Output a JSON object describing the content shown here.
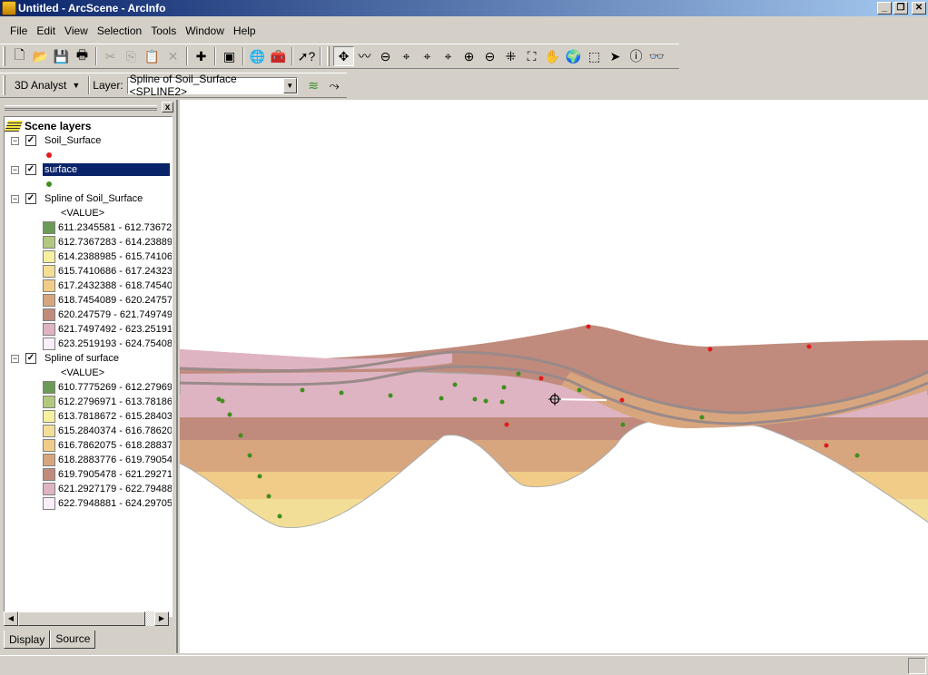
{
  "window": {
    "title": "Untitled - ArcScene - ArcInfo",
    "minimize": "_",
    "restore": "❐",
    "close": "✕"
  },
  "menu": [
    "File",
    "Edit",
    "View",
    "Selection",
    "Tools",
    "Window",
    "Help"
  ],
  "toolbar": {
    "standard": [
      {
        "name": "new-document-icon",
        "glyph": "🗋"
      },
      {
        "name": "open-folder-icon",
        "glyph": "📂"
      },
      {
        "name": "save-icon",
        "glyph": "💾"
      },
      {
        "name": "print-icon",
        "glyph": "🖶"
      },
      {
        "name": "cut-icon",
        "glyph": "✂",
        "disabled": true
      },
      {
        "name": "copy-icon",
        "glyph": "⎘",
        "disabled": true
      },
      {
        "name": "paste-icon",
        "glyph": "📋",
        "disabled": true
      },
      {
        "name": "delete-icon",
        "glyph": "✕",
        "disabled": true
      },
      {
        "name": "add-data-icon",
        "glyph": "✚"
      },
      {
        "name": "scene-properties-icon",
        "glyph": "▣"
      },
      {
        "name": "arccatalog-globe-icon",
        "glyph": "🌐"
      },
      {
        "name": "arctoolbox-icon",
        "glyph": "🧰"
      },
      {
        "name": "whats-this-help-icon",
        "glyph": "➚?"
      }
    ],
    "tools": [
      {
        "name": "navigate-icon",
        "glyph": "✥",
        "pressed": true
      },
      {
        "name": "fly-icon",
        "glyph": "〰"
      },
      {
        "name": "zoom-in-out-icon",
        "glyph": "⊖"
      },
      {
        "name": "center-on-target-icon",
        "glyph": "⌖"
      },
      {
        "name": "zoom-to-target-icon",
        "glyph": "⌖"
      },
      {
        "name": "set-observer-icon",
        "glyph": "⌖"
      },
      {
        "name": "zoom-in-icon",
        "glyph": "⊕"
      },
      {
        "name": "zoom-out-icon",
        "glyph": "⊖"
      },
      {
        "name": "narrow-field-of-view-icon",
        "glyph": "⁜"
      },
      {
        "name": "full-extent-icon",
        "glyph": "⛶"
      },
      {
        "name": "pan-hand-icon",
        "glyph": "✋"
      },
      {
        "name": "full-extent-globe-icon",
        "glyph": "🌍"
      },
      {
        "name": "select-features-icon",
        "glyph": "⬚"
      },
      {
        "name": "select-elements-arrow-icon",
        "glyph": "➤"
      },
      {
        "name": "identify-icon",
        "glyph": "ⓘ"
      },
      {
        "name": "find-binoculars-icon",
        "glyph": "👓"
      }
    ]
  },
  "analyst": {
    "menu_label": "3D Analyst",
    "layer_label": "Layer:",
    "layer_value": "Spline of Soil_Surface <SPLINE2>",
    "contour_icon": "≋",
    "steepest_path_icon": "⤳"
  },
  "toc": {
    "title": "Scene layers",
    "layers": [
      {
        "name": "Soil_Surface",
        "checked": true,
        "symbol": "#e21b1b"
      },
      {
        "name": "surface",
        "checked": true,
        "selected": true,
        "symbol": "#3f8f1e"
      },
      {
        "name": "Spline of Soil_Surface",
        "checked": true,
        "field": "<VALUE>",
        "classes": [
          {
            "label": "611.2345581 - 612.73672",
            "color": "#6e9a58"
          },
          {
            "label": "612.7367283 - 614.23889",
            "color": "#b3c87e"
          },
          {
            "label": "614.2388985 - 615.74106",
            "color": "#f5f0a0"
          },
          {
            "label": "615.7410686 - 617.24323",
            "color": "#f2de96"
          },
          {
            "label": "617.2432388 - 618.74540",
            "color": "#f0cc88"
          },
          {
            "label": "618.7454089 - 620.24757",
            "color": "#d8a67e"
          },
          {
            "label": "620.247579 - 621.749749",
            "color": "#c08b7c"
          },
          {
            "label": "621.7497492 - 623.25191",
            "color": "#dfb4c2"
          },
          {
            "label": "623.2519193 - 624.75408",
            "color": "#fbeefb"
          }
        ]
      },
      {
        "name": "Spline of surface",
        "checked": true,
        "field": "<VALUE>",
        "classes": [
          {
            "label": "610.7775269 - 612.27969",
            "color": "#6e9a58"
          },
          {
            "label": "612.2796971 - 613.78186",
            "color": "#b3c87e"
          },
          {
            "label": "613.7818672 - 615.28403",
            "color": "#f5f0a0"
          },
          {
            "label": "615.2840374 - 616.78620",
            "color": "#f2de96"
          },
          {
            "label": "616.7862075 - 618.28837",
            "color": "#f0cc88"
          },
          {
            "label": "618.2883776 - 619.79054",
            "color": "#d8a67e"
          },
          {
            "label": "619.7905478 - 621.29271",
            "color": "#c08b7c"
          },
          {
            "label": "621.2927179 - 622.79488",
            "color": "#dfb4c2"
          },
          {
            "label": "622.7948881 - 624.29705",
            "color": "#fbeefb"
          }
        ]
      }
    ],
    "tabs": [
      "Display",
      "Source"
    ],
    "active_tab": "Display"
  },
  "colors": {
    "selection": "#0a246a",
    "soil_point": "#e21b1b",
    "surface_point": "#3f8f1e"
  }
}
